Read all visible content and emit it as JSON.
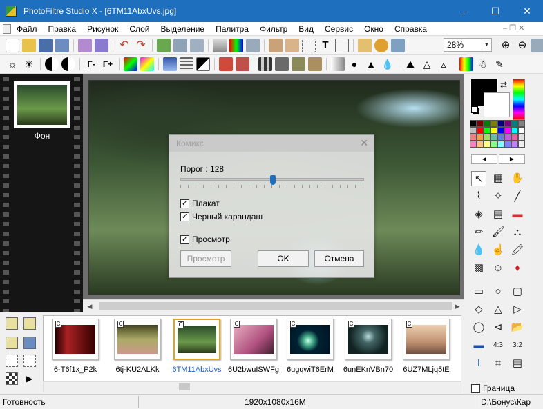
{
  "window": {
    "title": "PhotoFiltre Studio X - [6TM11AbxUvs.jpg]",
    "controls": [
      "–",
      "☐",
      "✕"
    ]
  },
  "menu": {
    "items": [
      "Файл",
      "Правка",
      "Рисунок",
      "Слой",
      "Выделение",
      "Палитра",
      "Фильтр",
      "Вид",
      "Сервис",
      "Окно",
      "Справка"
    ],
    "mdi_controls": "– ❐ ✕"
  },
  "toolbar": {
    "zoom": "28%"
  },
  "layers": {
    "label": "Фон"
  },
  "dialog": {
    "title": "Комикс",
    "threshold_label": "Порог : 128",
    "threshold_value": 128,
    "threshold_max": 255,
    "options": [
      {
        "label": "Плакат",
        "checked": true
      },
      {
        "label": "Черный карандаш",
        "checked": true
      },
      {
        "label": "Просмотр",
        "checked": true
      }
    ],
    "preview_button": "Просмотр",
    "ok_button": "OK",
    "cancel_button": "Отмена"
  },
  "thumbnails": [
    {
      "name": "6-T6f1x_P2k",
      "badge": "C",
      "selected": false
    },
    {
      "name": "6tj-KU2ALKk",
      "badge": "C",
      "selected": false
    },
    {
      "name": "6TM11AbxUvs",
      "badge": "C",
      "selected": true
    },
    {
      "name": "6U2bwuISWFg",
      "badge": "C",
      "selected": false
    },
    {
      "name": "6ugqwiT6ErM",
      "badge": "C",
      "selected": false
    },
    {
      "name": "6unEKnVBn70",
      "badge": "C",
      "selected": false
    },
    {
      "name": "6UZ7MLjq5tE",
      "badge": "C",
      "selected": false
    }
  ],
  "tools": {
    "border_label": "Граница"
  },
  "status": {
    "left": "Готовность",
    "center": "1920x1080x16M",
    "right": "D:\\Бонус\\Кар"
  },
  "colors": {
    "accent": "#1f6fbf",
    "selected_thumb": "#e6a21c",
    "selected_thumb_label": "#1f5fbf"
  }
}
